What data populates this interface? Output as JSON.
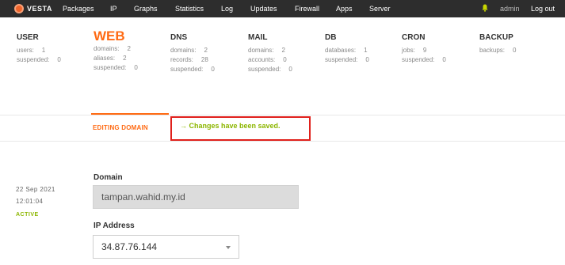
{
  "app": {
    "logo_text": "VESTA"
  },
  "nav": {
    "items": [
      "Packages",
      "IP",
      "Graphs",
      "Statistics",
      "Log",
      "Updates",
      "Firewall",
      "Apps",
      "Server"
    ],
    "user": "admin",
    "logout": "Log out"
  },
  "stats": [
    {
      "title": "USER",
      "active": false,
      "lines": [
        {
          "label": "users:",
          "value": "1"
        },
        {
          "label": "suspended:",
          "value": "0"
        }
      ]
    },
    {
      "title": "WEB",
      "active": true,
      "lines": [
        {
          "label": "domains:",
          "value": "2"
        },
        {
          "label": "aliases:",
          "value": "2"
        },
        {
          "label": "suspended:",
          "value": "0"
        }
      ]
    },
    {
      "title": "DNS",
      "active": false,
      "lines": [
        {
          "label": "domains:",
          "value": "2"
        },
        {
          "label": "records:",
          "value": "28"
        },
        {
          "label": "suspended:",
          "value": "0"
        }
      ]
    },
    {
      "title": "MAIL",
      "active": false,
      "lines": [
        {
          "label": "domains:",
          "value": "2"
        },
        {
          "label": "accounts:",
          "value": "0"
        },
        {
          "label": "suspended:",
          "value": "0"
        }
      ]
    },
    {
      "title": "DB",
      "active": false,
      "lines": [
        {
          "label": "databases:",
          "value": "1"
        },
        {
          "label": "suspended:",
          "value": "0"
        }
      ]
    },
    {
      "title": "CRON",
      "active": false,
      "lines": [
        {
          "label": "jobs:",
          "value": "9"
        },
        {
          "label": "suspended:",
          "value": "0"
        }
      ]
    },
    {
      "title": "BACKUP",
      "active": false,
      "lines": [
        {
          "label": "backups:",
          "value": "0"
        }
      ]
    }
  ],
  "edit": {
    "section_label": "EDITING DOMAIN",
    "saved_message": "→ Changes have been saved."
  },
  "meta": {
    "date": "22  Sep  2021",
    "time": "12:01:04",
    "status": "ACTIVE"
  },
  "form": {
    "domain_label": "Domain",
    "domain_value": "tampan.wahid.my.id",
    "ip_label": "IP Address",
    "ip_value": "34.87.76.144"
  },
  "colors": {
    "accent": "#ff6a13",
    "success": "#8cb600",
    "topbar": "#2d2d2d",
    "highlight_box": "#e0201b"
  }
}
